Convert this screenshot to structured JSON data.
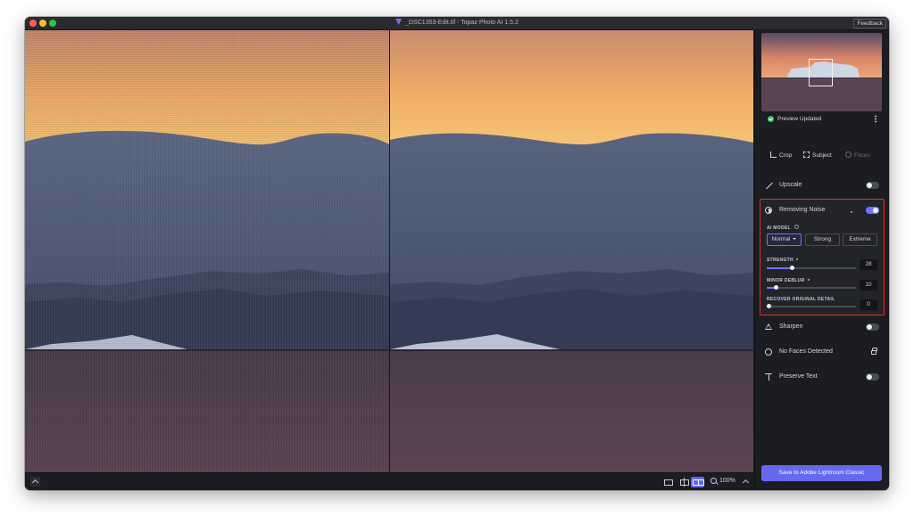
{
  "window": {
    "title": "_DSC1353-Edit.tif - Topaz Photo AI 1.5.2",
    "feedback_label": "Feedback"
  },
  "bottom_bar": {
    "zoom": "100%"
  },
  "sidebar": {
    "preview_status": "Preview Updated",
    "tools": {
      "crop": "Crop",
      "subject": "Subject",
      "faces": "Faces"
    },
    "upscale": {
      "label": "Upscale",
      "enabled": false
    },
    "noise": {
      "label": "Removing Noise",
      "enabled": true,
      "ai_model_label": "AI MODEL",
      "models": [
        "Normal",
        "Strong",
        "Extreme"
      ],
      "selected_model": "Normal",
      "strength_label": "STRENGTH",
      "strength_value": "28",
      "minor_deblur_label": "MINOR DEBLUR",
      "minor_deblur_value": "10",
      "recover_label": "RECOVER ORIGINAL DETAIL",
      "recover_value": "0"
    },
    "sharpen": {
      "label": "Sharpen",
      "enabled": false
    },
    "faces_detected": {
      "label": "No Faces Detected"
    },
    "preserve_text": {
      "label": "Preserve Text",
      "enabled": false
    },
    "save_button": "Save to Adobe Lightroom Classic"
  },
  "colors": {
    "accent": "#6d74ff",
    "highlight_border": "#e0321f",
    "sky_top": "#c78a6e",
    "sky_bottom": "#f6c774",
    "ice": "#56617c",
    "water": "#4b3d4c"
  },
  "icons": [
    "app-icon",
    "chevron-up-icon",
    "single-view-icon",
    "split-view-icon",
    "compare-view-icon",
    "zoom-icon",
    "check-icon",
    "kebab-icon",
    "crop-icon",
    "subject-icon",
    "faces-icon",
    "upscale-icon",
    "noise-icon",
    "info-icon",
    "sharpen-icon",
    "face-icon",
    "lock-icon",
    "text-icon"
  ]
}
